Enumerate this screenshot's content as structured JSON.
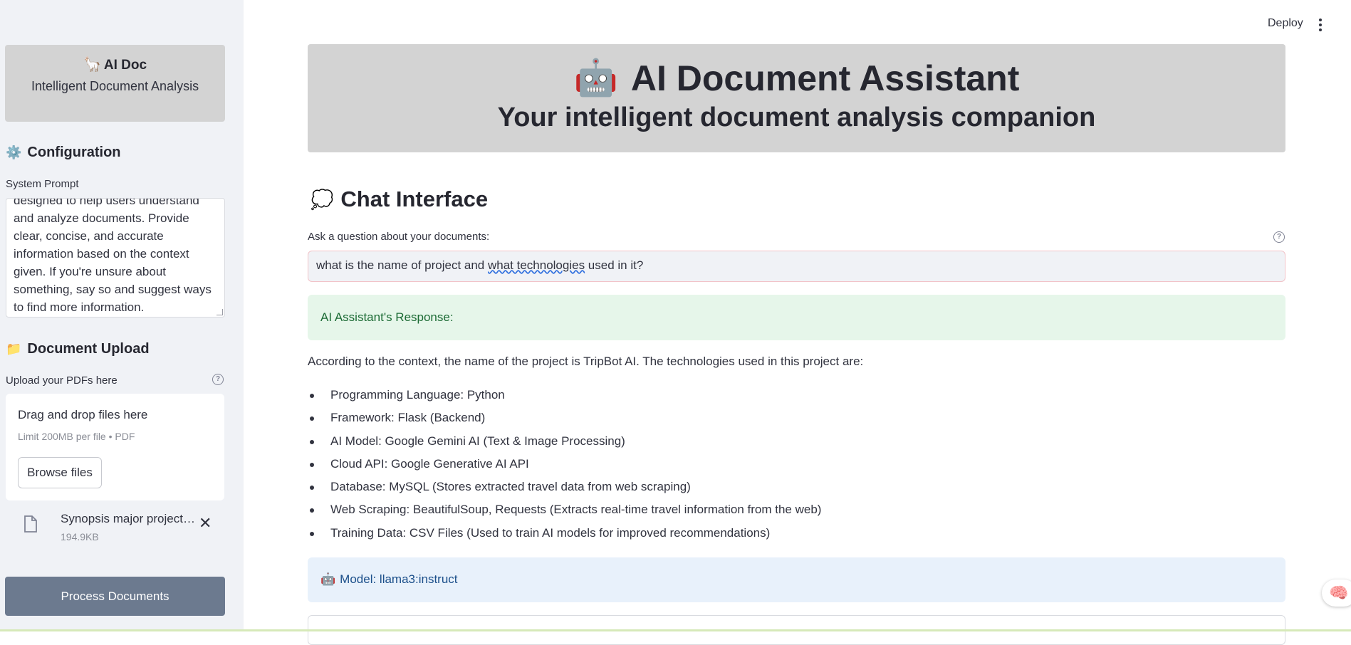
{
  "sidebar": {
    "brand": {
      "icon": "🦙",
      "title": "AI Doc",
      "subtitle": "Intelligent Document Analysis"
    },
    "configuration": {
      "icon": "⚙️",
      "heading": "Configuration"
    },
    "system_prompt": {
      "label": "System Prompt",
      "value": "designed to help users understand and analyze documents. Provide clear, concise, and accurate information based on the context given. If you're unsure about something, say so and suggest ways to find more information."
    },
    "document_upload": {
      "icon": "📁",
      "heading": "Document Upload"
    },
    "uploader": {
      "label": "Upload your PDFs here",
      "help": "?",
      "drop_title": "Drag and drop files here",
      "limit_text": "Limit 200MB per file • PDF",
      "browse_label": "Browse files"
    },
    "file": {
      "name": "Synopsis major project…",
      "size": "194.9KB",
      "remove": "✕"
    },
    "process_button": "Process Documents"
  },
  "header": {
    "deploy": "Deploy"
  },
  "hero": {
    "icon": "🤖",
    "title": "AI Document Assistant",
    "subtitle": "Your intelligent document analysis companion"
  },
  "chat": {
    "icon": "💭",
    "heading": "Chat Interface",
    "ask_label": "Ask a question about your documents:",
    "help": "?",
    "question": {
      "before": "what is the name of project and ",
      "squiggle": "what  technologies",
      "after": " used in it?"
    },
    "response_header": "AI Assistant's Response:",
    "answer_intro": "According to the context, the name of the project is TripBot AI. The technologies used in this project are:",
    "answer_items": [
      "Programming Language: Python",
      "Framework: Flask (Backend)",
      "AI Model: Google Gemini AI (Text & Image Processing)",
      "Cloud API: Google Generative AI API",
      "Database: MySQL (Stores extracted travel data from web scraping)",
      "Web Scraping: BeautifulSoup, Requests (Extracts real-time travel information from the web)",
      "Training Data: CSV Files (Used to train AI models for improved recommendations)"
    ],
    "model": {
      "icon": "🤖",
      "text": "Model: llama3:instruct"
    }
  },
  "floating": {
    "icon": "🧠"
  },
  "colors": {
    "sidebar_bg": "#f0f2f6",
    "hero_bg": "#d3d3d3",
    "success_bg": "#e6f6ea",
    "info_bg": "#e8f1fb",
    "primary_button": "#6c7a8f"
  }
}
